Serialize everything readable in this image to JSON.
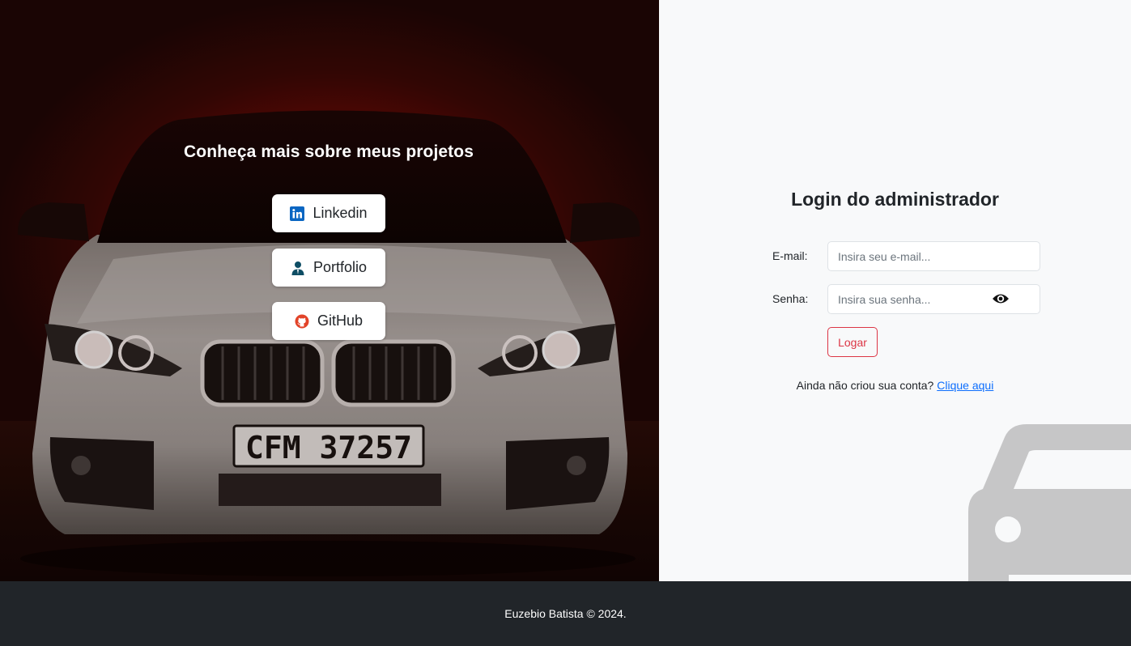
{
  "hero": {
    "title": "Conheça mais sobre meus projetos",
    "plate": "CFM  37257",
    "links": [
      {
        "label": "Linkedin",
        "icon": "linkedin-icon"
      },
      {
        "label": "Portfolio",
        "icon": "person-icon"
      },
      {
        "label": "GitHub",
        "icon": "github-icon"
      }
    ]
  },
  "login": {
    "title": "Login do administrador",
    "email_label": "E-mail:",
    "email_placeholder": "Insira seu e-mail...",
    "password_label": "Senha:",
    "password_placeholder": "Insira sua senha...",
    "submit_label": "Logar",
    "signup_text": "Ainda não criou sua conta?",
    "signup_link": "Clique aqui"
  },
  "footer": {
    "text": "Euzebio Batista © 2024."
  },
  "colors": {
    "accent_red": "#dc3545",
    "link_blue": "#0d6efd",
    "footer_bg": "#212529",
    "linkedin": "#0a66c2",
    "github": "#e24329",
    "portfolio": "#0e4d64"
  }
}
